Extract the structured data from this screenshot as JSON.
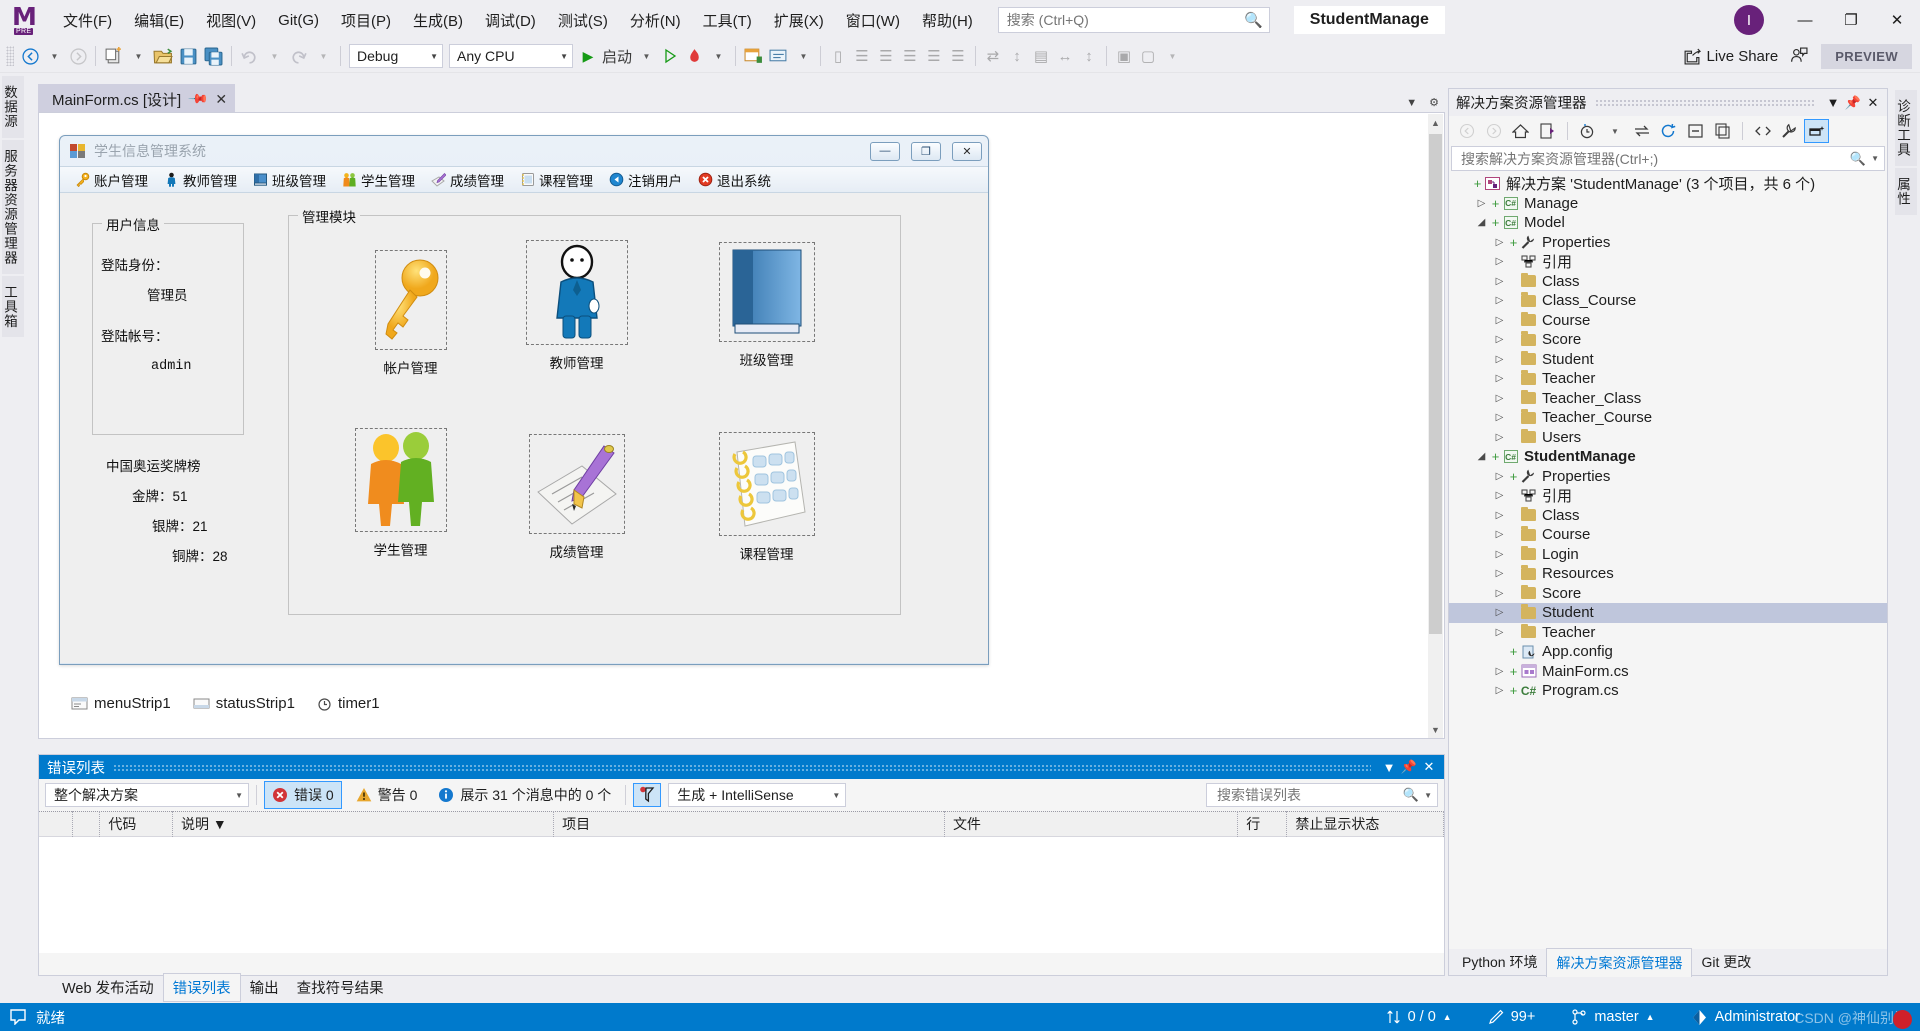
{
  "titlebar": {
    "logo_letter": "M",
    "logo_tag": "PRE",
    "menus": [
      {
        "label": "文件(F)"
      },
      {
        "label": "编辑(E)"
      },
      {
        "label": "视图(V)"
      },
      {
        "label": "Git(G)"
      },
      {
        "label": "项目(P)"
      },
      {
        "label": "生成(B)"
      },
      {
        "label": "调试(D)"
      },
      {
        "label": "测试(S)"
      },
      {
        "label": "分析(N)"
      },
      {
        "label": "工具(T)"
      },
      {
        "label": "扩展(X)"
      },
      {
        "label": "窗口(W)"
      },
      {
        "label": "帮助(H)"
      }
    ],
    "search_placeholder": "搜索 (Ctrl+Q)",
    "search_value": "",
    "search_icon": "search-icon",
    "project_badge": "StudentManage",
    "avatar_letter": "I",
    "window_buttons": {
      "minimize": "—",
      "maximize": "❐",
      "close": "✕"
    }
  },
  "toolbar": {
    "nav_back": "←",
    "nav_forward": "→",
    "config": "Debug",
    "platform": "Any CPU",
    "start_label": "启动",
    "live_share": "Live Share",
    "preview_badge": "PREVIEW",
    "buttons": [
      {
        "name": "new-item-button"
      },
      {
        "name": "open-file-button"
      },
      {
        "name": "save-button"
      },
      {
        "name": "save-all-button"
      },
      {
        "name": "undo-button"
      },
      {
        "name": "redo-button"
      }
    ]
  },
  "left_strip": [
    {
      "label": "数据源"
    },
    {
      "label": "服务器资源管理器"
    },
    {
      "label": "工具箱"
    }
  ],
  "right_strip": [
    {
      "label": "诊断工具"
    },
    {
      "label": "属性"
    }
  ],
  "document": {
    "tab_label": "MainForm.cs [设计]",
    "pin_icon": "pin-icon",
    "close_icon": "close-icon"
  },
  "form": {
    "title": "学生信息管理系统",
    "caption_buttons": {
      "minimize": "—",
      "maximize": "❐",
      "close": "✕"
    },
    "menu_items": [
      {
        "label": "账户管理",
        "icon": "key-icon"
      },
      {
        "label": "教师管理",
        "icon": "teacher-icon"
      },
      {
        "label": "班级管理",
        "icon": "book-icon"
      },
      {
        "label": "学生管理",
        "icon": "students-icon"
      },
      {
        "label": "成绩管理",
        "icon": "pencil-paper-icon"
      },
      {
        "label": "课程管理",
        "icon": "notebook-icon"
      },
      {
        "label": "注销用户",
        "icon": "logout-icon"
      },
      {
        "label": "退出系统",
        "icon": "exit-icon"
      }
    ],
    "user_group": {
      "legend": "用户信息",
      "role_label": "登陆身份：",
      "role_value": "管理员",
      "account_label": "登陆帐号：",
      "account_value": "admin"
    },
    "medals": {
      "title": "中国奥运奖牌榜",
      "gold": "金牌：51",
      "silver": "银牌：21",
      "bronze": "铜牌：28"
    },
    "module_group": {
      "legend": "管理模块",
      "items": [
        {
          "label": "帐户管理",
          "icon": "key-icon"
        },
        {
          "label": "教师管理",
          "icon": "teacher-icon"
        },
        {
          "label": "班级管理",
          "icon": "book-icon"
        },
        {
          "label": "学生管理",
          "icon": "students-icon"
        },
        {
          "label": "成绩管理",
          "icon": "pencil-paper-icon"
        },
        {
          "label": "课程管理",
          "icon": "notebook-icon"
        }
      ]
    }
  },
  "component_tray": [
    {
      "label": "menuStrip1",
      "icon": "menustrip-icon"
    },
    {
      "label": "statusStrip1",
      "icon": "statusstrip-icon"
    },
    {
      "label": "timer1",
      "icon": "timer-icon"
    }
  ],
  "solution_explorer": {
    "title": "解决方案资源管理器",
    "header_buttons": {
      "dropdown": "▼",
      "pin": "pin-icon",
      "close": "✕"
    },
    "search_placeholder": "搜索解决方案资源管理器(Ctrl+;)",
    "search_value": "",
    "toolbar_icons": [
      "back-icon",
      "forward-icon",
      "home-icon",
      "sync-with-active-document-icon",
      "pending-changes-icon",
      "switch-views-icon",
      "refresh-icon",
      "collapse-all-icon",
      "show-all-files-icon",
      "view-code-icon",
      "properties-icon",
      "preview-selected-items-icon"
    ],
    "tree": [
      {
        "indent": 0,
        "twisty": "",
        "plus": true,
        "icon": "solution-icon",
        "label": "解决方案 'StudentManage' (3 个项目，共 6 个)",
        "bold": false
      },
      {
        "indent": 1,
        "twisty": "▷",
        "plus": true,
        "icon": "csharp-project-icon",
        "label": "Manage",
        "bold": false
      },
      {
        "indent": 1,
        "twisty": "◢",
        "plus": true,
        "icon": "csharp-project-icon",
        "label": "Model",
        "bold": false
      },
      {
        "indent": 2,
        "twisty": "▷",
        "plus": true,
        "icon": "properties-icon",
        "label": "Properties",
        "bold": false
      },
      {
        "indent": 2,
        "twisty": "▷",
        "plus": false,
        "icon": "references-icon",
        "label": "引用",
        "bold": false
      },
      {
        "indent": 2,
        "twisty": "▷",
        "plus": false,
        "icon": "folder-icon",
        "label": "Class",
        "bold": false
      },
      {
        "indent": 2,
        "twisty": "▷",
        "plus": false,
        "icon": "folder-icon",
        "label": "Class_Course",
        "bold": false
      },
      {
        "indent": 2,
        "twisty": "▷",
        "plus": false,
        "icon": "folder-icon",
        "label": "Course",
        "bold": false
      },
      {
        "indent": 2,
        "twisty": "▷",
        "plus": false,
        "icon": "folder-icon",
        "label": "Score",
        "bold": false
      },
      {
        "indent": 2,
        "twisty": "▷",
        "plus": false,
        "icon": "folder-icon",
        "label": "Student",
        "bold": false
      },
      {
        "indent": 2,
        "twisty": "▷",
        "plus": false,
        "icon": "folder-icon",
        "label": "Teacher",
        "bold": false
      },
      {
        "indent": 2,
        "twisty": "▷",
        "plus": false,
        "icon": "folder-icon",
        "label": "Teacher_Class",
        "bold": false
      },
      {
        "indent": 2,
        "twisty": "▷",
        "plus": false,
        "icon": "folder-icon",
        "label": "Teacher_Course",
        "bold": false
      },
      {
        "indent": 2,
        "twisty": "▷",
        "plus": false,
        "icon": "folder-icon",
        "label": "Users",
        "bold": false
      },
      {
        "indent": 1,
        "twisty": "◢",
        "plus": true,
        "icon": "csharp-project-icon",
        "label": "StudentManage",
        "bold": true
      },
      {
        "indent": 2,
        "twisty": "▷",
        "plus": true,
        "icon": "properties-icon",
        "label": "Properties",
        "bold": false
      },
      {
        "indent": 2,
        "twisty": "▷",
        "plus": false,
        "icon": "references-icon",
        "label": "引用",
        "bold": false
      },
      {
        "indent": 2,
        "twisty": "▷",
        "plus": false,
        "icon": "folder-icon",
        "label": "Class",
        "bold": false
      },
      {
        "indent": 2,
        "twisty": "▷",
        "plus": false,
        "icon": "folder-icon",
        "label": "Course",
        "bold": false
      },
      {
        "indent": 2,
        "twisty": "▷",
        "plus": false,
        "icon": "folder-icon",
        "label": "Login",
        "bold": false
      },
      {
        "indent": 2,
        "twisty": "▷",
        "plus": false,
        "icon": "folder-icon",
        "label": "Resources",
        "bold": false
      },
      {
        "indent": 2,
        "twisty": "▷",
        "plus": false,
        "icon": "folder-icon",
        "label": "Score",
        "bold": false
      },
      {
        "indent": 2,
        "twisty": "▷",
        "plus": false,
        "icon": "folder-icon",
        "label": "Student",
        "bold": false,
        "selected": true
      },
      {
        "indent": 2,
        "twisty": "▷",
        "plus": false,
        "icon": "folder-icon",
        "label": "Teacher",
        "bold": false
      },
      {
        "indent": 2,
        "twisty": "",
        "plus": true,
        "icon": "config-icon",
        "label": "App.config",
        "bold": false
      },
      {
        "indent": 2,
        "twisty": "▷",
        "plus": true,
        "icon": "form-icon",
        "label": "MainForm.cs",
        "bold": false
      },
      {
        "indent": 2,
        "twisty": "▷",
        "plus": true,
        "icon": "csharp-file-icon",
        "label": "Program.cs",
        "bold": false
      }
    ],
    "bottom_tabs": [
      {
        "label": "Python 环境",
        "active": false
      },
      {
        "label": "解决方案资源管理器",
        "active": true
      },
      {
        "label": "Git 更改",
        "active": false
      }
    ]
  },
  "error_list": {
    "title": "错误列表",
    "header_buttons": {
      "dropdown": "▼",
      "pin": "pin-icon",
      "close": "✕"
    },
    "scope": "整个解决方案",
    "errors_label": "错误 0",
    "warnings_label": "警告 0",
    "messages_label": "展示 31 个消息中的 0 个",
    "filter_badge": "build-filter-icon",
    "build_filter": "生成 + IntelliSense",
    "search_placeholder": "搜索错误列表",
    "search_value": "",
    "columns": [
      "",
      "",
      "代码",
      "说明 ▼",
      "项目",
      "文件",
      "行",
      "禁止显示状态"
    ],
    "rows": []
  },
  "bottom_tabs": [
    {
      "label": "Web 发布活动",
      "active": false
    },
    {
      "label": "错误列表",
      "active": true
    },
    {
      "label": "输出",
      "active": false
    },
    {
      "label": "查找符号结果",
      "active": false
    }
  ],
  "status_bar": {
    "ready": "就绪",
    "ready_icon": "ready-icon",
    "sync": "0 / 0",
    "sync_icon": "updown-arrows-icon",
    "pending": "99+",
    "pending_icon": "pencil-icon",
    "branch": "master",
    "branch_icon": "branch-icon",
    "user": "Administrator",
    "user_icon": "vs-user-icon",
    "watermark": "CSDN @神仙别闹"
  },
  "colors": {
    "accent": "#007ACC",
    "brand_purple": "#68217A",
    "selection": "#BFC6DC",
    "folder": "#D4B45E"
  }
}
